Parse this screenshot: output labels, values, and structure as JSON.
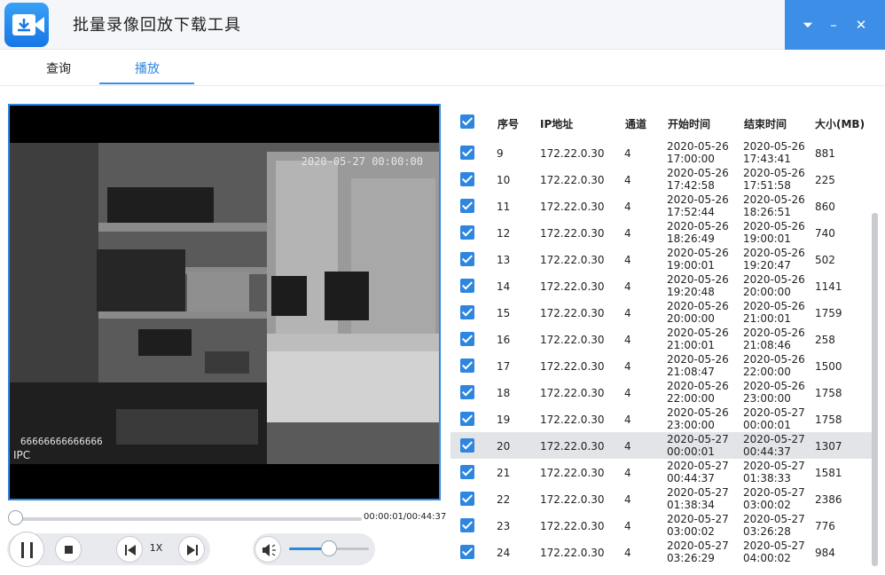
{
  "app": {
    "title": "批量录像回放下载工具"
  },
  "window_controls": {
    "dropdown": "⏷",
    "minimize": "–",
    "close": "✕"
  },
  "tabs": [
    {
      "label": "查询"
    },
    {
      "label": "播放"
    }
  ],
  "player": {
    "osd_time": "2020-05-27 00:00:00",
    "osd_id": "66666666666666",
    "osd_ipc": "IPC",
    "time_display": "00:00:01/00:44:37",
    "progress": 0.0004,
    "speed": "1X",
    "volume": 0.5
  },
  "table": {
    "headers": {
      "index": "序号",
      "ip": "IP地址",
      "channel": "通道",
      "start": "开始时间",
      "end": "结束时间",
      "size": "大小(MB)"
    },
    "selected_row_index": 11,
    "rows": [
      {
        "no": "9",
        "ip": "172.22.0.30",
        "ch": "4",
        "start_d": "2020-05-26",
        "start_t": "17:00:00",
        "end_d": "2020-05-26",
        "end_t": "17:43:41",
        "size": "881"
      },
      {
        "no": "10",
        "ip": "172.22.0.30",
        "ch": "4",
        "start_d": "2020-05-26",
        "start_t": "17:42:58",
        "end_d": "2020-05-26",
        "end_t": "17:51:58",
        "size": "225"
      },
      {
        "no": "11",
        "ip": "172.22.0.30",
        "ch": "4",
        "start_d": "2020-05-26",
        "start_t": "17:52:44",
        "end_d": "2020-05-26",
        "end_t": "18:26:51",
        "size": "860"
      },
      {
        "no": "12",
        "ip": "172.22.0.30",
        "ch": "4",
        "start_d": "2020-05-26",
        "start_t": "18:26:49",
        "end_d": "2020-05-26",
        "end_t": "19:00:01",
        "size": "740"
      },
      {
        "no": "13",
        "ip": "172.22.0.30",
        "ch": "4",
        "start_d": "2020-05-26",
        "start_t": "19:00:01",
        "end_d": "2020-05-26",
        "end_t": "19:20:47",
        "size": "502"
      },
      {
        "no": "14",
        "ip": "172.22.0.30",
        "ch": "4",
        "start_d": "2020-05-26",
        "start_t": "19:20:48",
        "end_d": "2020-05-26",
        "end_t": "20:00:00",
        "size": "1141"
      },
      {
        "no": "15",
        "ip": "172.22.0.30",
        "ch": "4",
        "start_d": "2020-05-26",
        "start_t": "20:00:00",
        "end_d": "2020-05-26",
        "end_t": "21:00:01",
        "size": "1759"
      },
      {
        "no": "16",
        "ip": "172.22.0.30",
        "ch": "4",
        "start_d": "2020-05-26",
        "start_t": "21:00:01",
        "end_d": "2020-05-26",
        "end_t": "21:08:46",
        "size": "258"
      },
      {
        "no": "17",
        "ip": "172.22.0.30",
        "ch": "4",
        "start_d": "2020-05-26",
        "start_t": "21:08:47",
        "end_d": "2020-05-26",
        "end_t": "22:00:00",
        "size": "1500"
      },
      {
        "no": "18",
        "ip": "172.22.0.30",
        "ch": "4",
        "start_d": "2020-05-26",
        "start_t": "22:00:00",
        "end_d": "2020-05-26",
        "end_t": "23:00:00",
        "size": "1758"
      },
      {
        "no": "19",
        "ip": "172.22.0.30",
        "ch": "4",
        "start_d": "2020-05-26",
        "start_t": "23:00:00",
        "end_d": "2020-05-27",
        "end_t": "00:00:01",
        "size": "1758"
      },
      {
        "no": "20",
        "ip": "172.22.0.30",
        "ch": "4",
        "start_d": "2020-05-27",
        "start_t": "00:00:01",
        "end_d": "2020-05-27",
        "end_t": "00:44:37",
        "size": "1307"
      },
      {
        "no": "21",
        "ip": "172.22.0.30",
        "ch": "4",
        "start_d": "2020-05-27",
        "start_t": "00:44:37",
        "end_d": "2020-05-27",
        "end_t": "01:38:33",
        "size": "1581"
      },
      {
        "no": "22",
        "ip": "172.22.0.30",
        "ch": "4",
        "start_d": "2020-05-27",
        "start_t": "01:38:34",
        "end_d": "2020-05-27",
        "end_t": "03:00:02",
        "size": "2386"
      },
      {
        "no": "23",
        "ip": "172.22.0.30",
        "ch": "4",
        "start_d": "2020-05-27",
        "start_t": "03:00:02",
        "end_d": "2020-05-27",
        "end_t": "03:26:28",
        "size": "776"
      },
      {
        "no": "24",
        "ip": "172.22.0.30",
        "ch": "4",
        "start_d": "2020-05-27",
        "start_t": "03:26:29",
        "end_d": "2020-05-27",
        "end_t": "04:00:02",
        "size": "984"
      }
    ]
  }
}
